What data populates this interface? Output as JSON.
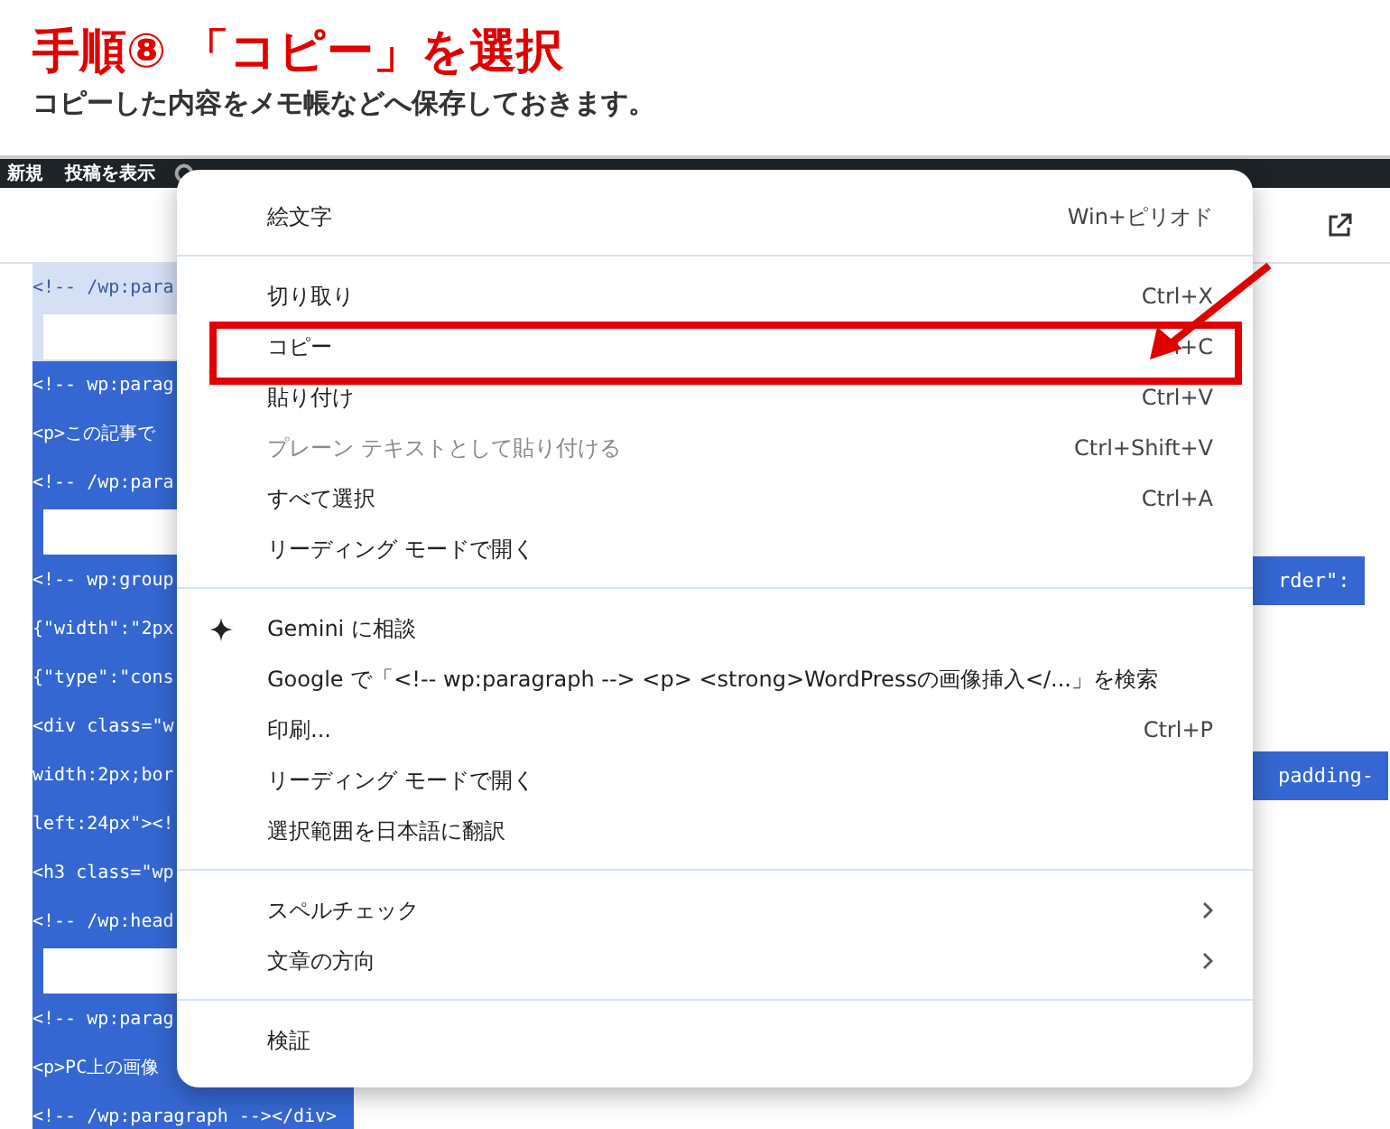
{
  "heading": {
    "title": "手順⑧ 「コピー」を選択",
    "subtitle": "コピーした内容をメモ帳などへ保存しておきます。"
  },
  "admin_bar": {
    "items": [
      "新規",
      "投稿を表示"
    ]
  },
  "editor": {
    "rows": [
      {
        "kind": "code",
        "selected": false,
        "text": "<!-- /wp:para"
      },
      {
        "kind": "blank",
        "selected": false
      },
      {
        "kind": "code",
        "selected": true,
        "text": "<!-- wp:parag"
      },
      {
        "kind": "code",
        "selected": true,
        "text": "<p>この記事で"
      },
      {
        "kind": "code",
        "selected": true,
        "text": "<!-- /wp:para"
      },
      {
        "kind": "blank",
        "selected": true
      },
      {
        "kind": "code",
        "selected": true,
        "text": "<!-- wp:group",
        "tail": "rder\":"
      },
      {
        "kind": "code",
        "selected": true,
        "text": "{\"width\":\"2px"
      },
      {
        "kind": "code",
        "selected": true,
        "text": "{\"type\":\"cons"
      },
      {
        "kind": "code",
        "selected": true,
        "text": "<div class=\"w"
      },
      {
        "kind": "code",
        "selected": true,
        "text": "width:2px;bor",
        "tail": "padding-"
      },
      {
        "kind": "code",
        "selected": true,
        "text": "left:24px\"><!"
      },
      {
        "kind": "code",
        "selected": true,
        "text": "<h3 class=\"wp"
      },
      {
        "kind": "code",
        "selected": true,
        "text": "<!-- /wp:head"
      },
      {
        "kind": "blank",
        "selected": true
      },
      {
        "kind": "code",
        "selected": true,
        "text": "<!-- wp:parag"
      },
      {
        "kind": "code",
        "selected": true,
        "text": "<p>PC上の画像"
      },
      {
        "kind": "code",
        "selected": true,
        "text": "<!-- /wp:paragraph --></div>"
      }
    ]
  },
  "context_menu": {
    "sections": [
      {
        "items": [
          {
            "label": "絵文字",
            "shortcut": "Win+ピリオド",
            "disabled": false,
            "submenu": false,
            "highlighted": false
          }
        ]
      },
      {
        "items": [
          {
            "label": "切り取り",
            "shortcut": "Ctrl+X",
            "disabled": false,
            "submenu": false,
            "highlighted": false
          },
          {
            "label": "コピー",
            "shortcut": "l+C",
            "disabled": false,
            "submenu": false,
            "highlighted": true
          },
          {
            "label": "貼り付け",
            "shortcut": "Ctrl+V",
            "disabled": false,
            "submenu": false,
            "highlighted": false
          },
          {
            "label": "プレーン テキストとして貼り付ける",
            "shortcut": "Ctrl+Shift+V",
            "disabled": true,
            "submenu": false,
            "highlighted": false
          },
          {
            "label": "すべて選択",
            "shortcut": "Ctrl+A",
            "disabled": false,
            "submenu": false,
            "highlighted": false
          },
          {
            "label": "リーディング モードで開く",
            "disabled": false,
            "submenu": false,
            "highlighted": false
          }
        ]
      },
      {
        "items": [
          {
            "label": "Gemini に相談",
            "kind": "ai",
            "disabled": false,
            "submenu": false,
            "highlighted": false
          },
          {
            "label": "Google で「<!-- wp:paragraph -->  <p> <strong>WordPressの画像挿入</...」を検索",
            "disabled": false,
            "submenu": false,
            "highlighted": false
          },
          {
            "label": "印刷...",
            "shortcut": "Ctrl+P",
            "disabled": false,
            "submenu": false,
            "highlighted": false
          },
          {
            "label": "リーディング モードで開く",
            "disabled": false,
            "submenu": false,
            "highlighted": false
          },
          {
            "label": "選択範囲を日本語に翻訳",
            "disabled": false,
            "submenu": false,
            "highlighted": false
          }
        ]
      },
      {
        "items": [
          {
            "label": "スペルチェック",
            "disabled": false,
            "submenu": true,
            "highlighted": false
          },
          {
            "label": "文章の方向",
            "disabled": false,
            "submenu": true,
            "highlighted": false
          }
        ]
      },
      {
        "items": [
          {
            "label": "検証",
            "disabled": false,
            "submenu": false,
            "highlighted": false
          }
        ]
      }
    ]
  }
}
